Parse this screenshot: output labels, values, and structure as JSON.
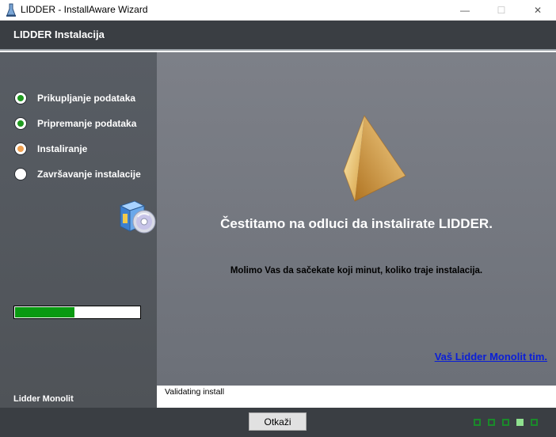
{
  "window": {
    "title": "LIDDER - InstallAware Wizard",
    "minimize_glyph": "—",
    "maximize_glyph": "☐",
    "close_glyph": "✕"
  },
  "header": {
    "title": "LIDDER Instalacija"
  },
  "sidebar": {
    "steps": [
      {
        "label": "Prikupljanje podataka",
        "state": "done"
      },
      {
        "label": "Pripremanje podataka",
        "state": "done"
      },
      {
        "label": "Instaliranje",
        "state": "current"
      },
      {
        "label": "Završavanje instalacije",
        "state": "pending"
      }
    ],
    "progress_fraction": 0.48,
    "company": "Lidder Monolit"
  },
  "main": {
    "congrats": "Čestitamo na odluci da instalirate LIDDER.",
    "wait_message": "Molimo Vas da sačekate koji minut, koliko traje instalacija.",
    "team_link": "Vaš Lidder Monolit tim."
  },
  "status": {
    "text": "Validating install"
  },
  "footer": {
    "cancel_label": "Otkaži",
    "page_count": 5,
    "active_page": 4
  },
  "colors": {
    "step_done": "#1f9a1f",
    "step_current": "#f0a050",
    "progress": "#0a9a12",
    "link": "#0b1fd6"
  }
}
